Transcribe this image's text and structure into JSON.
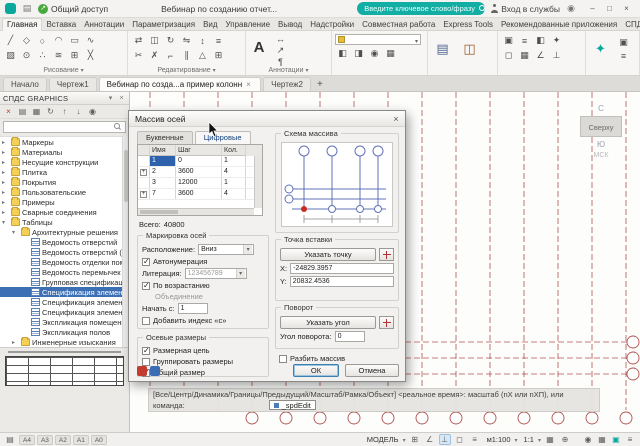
{
  "titlebar": {
    "share_label": "Общий доступ",
    "doc_title": "Вебинар по созданию отчет...",
    "search_placeholder": "Введите ключевое слово/фразу",
    "signin_label": "Вход в службы",
    "minimize": "–",
    "maximize": "□",
    "close": "×"
  },
  "ribbon": {
    "tabs": [
      {
        "label": "Главная",
        "active": true
      },
      {
        "label": "Вставка"
      },
      {
        "label": "Аннотации"
      },
      {
        "label": "Параметризация"
      },
      {
        "label": "Вид"
      },
      {
        "label": "Управление"
      },
      {
        "label": "Вывод"
      },
      {
        "label": "Надстройки"
      },
      {
        "label": "Совместная работа"
      },
      {
        "label": "Express Tools"
      },
      {
        "label": "Рекомендованные приложения"
      },
      {
        "label": "СПДС"
      }
    ],
    "panels": [
      {
        "label": "Рисование"
      },
      {
        "label": "Редактирование"
      },
      {
        "label": "Аннотации"
      }
    ]
  },
  "doc_tabs": {
    "items": [
      {
        "label": "Начало"
      },
      {
        "label": "Чертеж1"
      },
      {
        "label": "Вебинар по созда...а пример колонн",
        "active": true
      },
      {
        "label": "Чертеж2"
      }
    ],
    "add_label": "+"
  },
  "palette": {
    "title": "СПДС GRAPHICS",
    "tree": [
      {
        "label": "Маркеры",
        "level": 0
      },
      {
        "label": "Материалы",
        "level": 0
      },
      {
        "label": "Несущие конструкции",
        "level": 0
      },
      {
        "label": "Плитка",
        "level": 0
      },
      {
        "label": "Покрытия",
        "level": 0
      },
      {
        "label": "Пользовательские",
        "level": 0
      },
      {
        "label": "Примеры",
        "level": 0
      },
      {
        "label": "Сварные соединения",
        "level": 0
      },
      {
        "label": "Таблицы",
        "level": 0,
        "expanded": true
      },
      {
        "label": "Архитектурные решения",
        "level": 1,
        "expanded": true
      },
      {
        "label": "Ведомость отверстий",
        "level": 2,
        "leaf": true
      },
      {
        "label": "Ведомость отверстий (с раз...",
        "level": 2,
        "leaf": true
      },
      {
        "label": "Ведомость отделки помещ...",
        "level": 2,
        "leaf": true
      },
      {
        "label": "Ведомость перемычек",
        "level": 2,
        "leaf": true
      },
      {
        "label": "Групповая спецификация э...",
        "level": 2,
        "leaf": true
      },
      {
        "label": "Спецификация элементов",
        "level": 2,
        "leaf": true,
        "selected": true
      },
      {
        "label": "Спецификация элементов з...",
        "level": 2,
        "leaf": true
      },
      {
        "label": "Спецификация элементов и...",
        "level": 2,
        "leaf": true
      },
      {
        "label": "Экспликация помещений",
        "level": 2,
        "leaf": true
      },
      {
        "label": "Экспликация полов",
        "level": 2,
        "leaf": true
      },
      {
        "label": "Инженерные изыскания",
        "level": 1
      }
    ]
  },
  "dialog": {
    "title": "Массив осей",
    "tabs": [
      {
        "label": "Буквенные"
      },
      {
        "label": "Цифровые",
        "active": true
      }
    ],
    "grid": {
      "headers": [
        "Имя",
        "Шаг",
        "Кол."
      ],
      "rows": [
        {
          "name": "1",
          "step": "0",
          "count": "1",
          "selected": true
        },
        {
          "name": "2",
          "step": "3600",
          "count": "4",
          "expandable": true
        },
        {
          "name": "3",
          "step": "12000",
          "count": "1"
        },
        {
          "name": "7",
          "step": "3600",
          "count": "4",
          "expandable": true
        }
      ]
    },
    "total_label": "Всего:",
    "total_value": "40800",
    "marking": {
      "title": "Маркировка осей",
      "location_label": "Расположение:",
      "location_value": "Вниз",
      "autonumber_label": "Автонумерация",
      "autonumber_checked": true,
      "literation_label": "Литерация:",
      "literation_value": "123456789",
      "ascending_label": "По возрастанию",
      "ascending_checked": true,
      "merge_label": "Объединение",
      "start_label": "Начать с:",
      "start_value": "1",
      "index_label": "Добавить индекс «с»",
      "index_checked": false
    },
    "axis_dims": {
      "title": "Осевые размеры",
      "items": [
        {
          "label": "Размерная цепь",
          "checked": true
        },
        {
          "label": "Группировать размеры",
          "checked": false
        },
        {
          "label": "Общий размер",
          "checked": true
        }
      ]
    },
    "scheme_title": "Схема массива",
    "insertion": {
      "title": "Точка вставки",
      "pick_label": "Указать точку",
      "x_label": "X:",
      "x_value": "-24829.3957",
      "y_label": "Y:",
      "y_value": "20832.4536"
    },
    "rotation": {
      "title": "Поворот",
      "pick_label": "Указать угол",
      "angle_label": "Угол поворота:",
      "angle_value": "0"
    },
    "explode_label": "Разбить массив",
    "explode_checked": false,
    "ok_label": "ОК",
    "cancel_label": "Отмена"
  },
  "viewcube": {
    "north": "С",
    "south": "Ю",
    "top_face": "Сверху",
    "cs_label": "МСК"
  },
  "command": {
    "history_line": "[Все/Центр/Динамика/Границы/Предыдущий/Масштаб/Рамка/Объект] <реальное время>: масштаб (nX или nXП), или",
    "prompt": "команда:",
    "suggestion": "_spdEdit"
  },
  "statusbar": {
    "sheets": [
      "А4",
      "А3",
      "А2",
      "А1",
      "А0"
    ],
    "model_label": "МОДЕЛЬ",
    "annot_scale": "м1:100",
    "scale": "1:1"
  }
}
